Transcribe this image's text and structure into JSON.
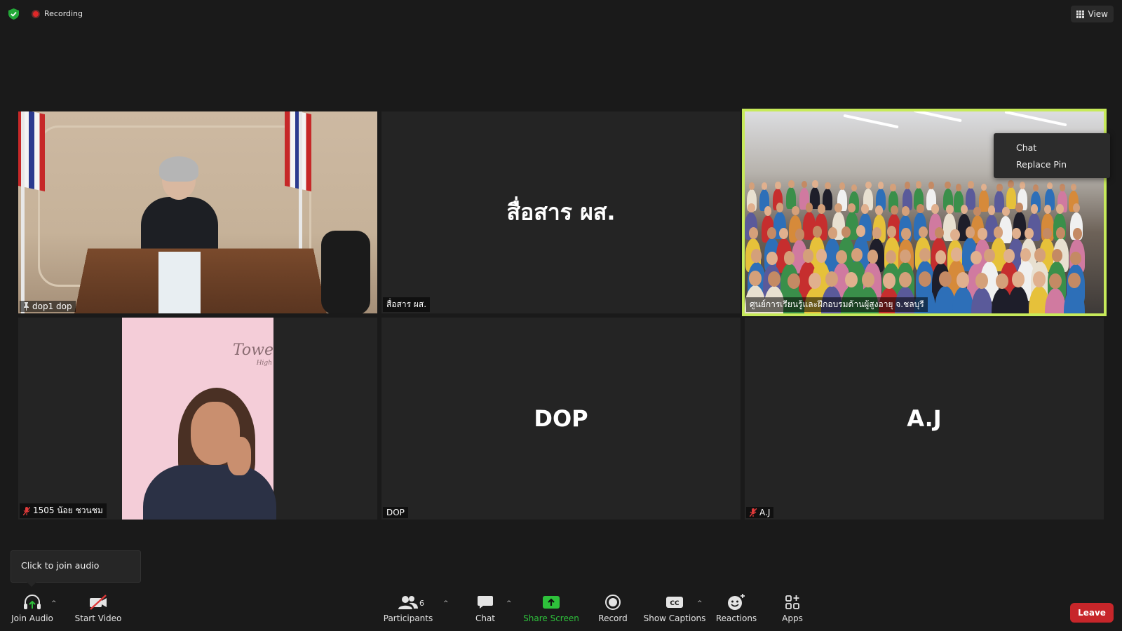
{
  "topbar": {
    "security_icon": "shield-check-icon",
    "recording_label": "Recording",
    "view_label": "View"
  },
  "tiles": [
    {
      "name": "dop1 dop",
      "big_name": "",
      "status_icon": "pin-icon",
      "type": "video"
    },
    {
      "name": "สื่อสาร ผส.",
      "big_name": "สื่อสาร ผส.",
      "status_icon": "",
      "type": "avatar"
    },
    {
      "name": "ศูนย์การเรียนรู้และฝึกอบรมด้านผู้สูงอายุ จ.ชลบุรี",
      "big_name": "",
      "status_icon": "",
      "type": "video",
      "active_speaker": true
    },
    {
      "name": "1505 น้อย ชวนชม",
      "big_name": "",
      "status_icon": "mic-muted-icon",
      "type": "video"
    },
    {
      "name": "DOP",
      "big_name": "DOP",
      "status_icon": "",
      "type": "avatar"
    },
    {
      "name": "A.J",
      "big_name": "A.J",
      "status_icon": "mic-muted-icon",
      "type": "avatar"
    }
  ],
  "video4_logo": "Towe",
  "video4_logo_sub": "High",
  "context_menu": {
    "items": [
      "Chat",
      "Replace Pin"
    ]
  },
  "tooltip": {
    "text": "Click to join audio"
  },
  "toolbar": {
    "join_audio": "Join Audio",
    "start_video": "Start Video",
    "participants": "Participants",
    "participants_count": "6",
    "chat": "Chat",
    "share_screen": "Share Screen",
    "record": "Record",
    "show_captions": "Show Captions",
    "reactions": "Reactions",
    "apps": "Apps",
    "leave": "Leave"
  },
  "colors": {
    "background": "#1a1a1a",
    "tile": "#242424",
    "active_speaker_border": "#c7ea5a",
    "share_green": "#2ec13b",
    "leave_red": "#c7262a"
  }
}
